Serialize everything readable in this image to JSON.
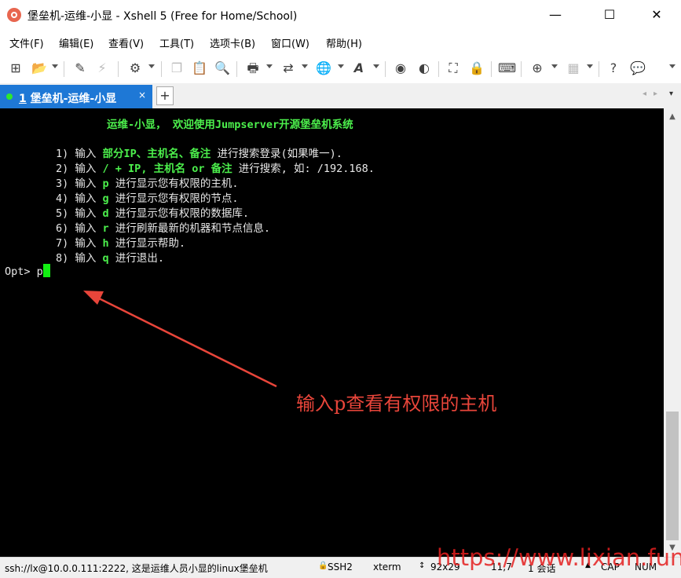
{
  "window": {
    "title": "堡垒机-运维-小显 - Xshell 5 (Free for Home/School)",
    "controls": {
      "minimize": "—",
      "maximize": "☐",
      "close": "✕"
    }
  },
  "menu": [
    "文件(F)",
    "编辑(E)",
    "查看(V)",
    "工具(T)",
    "选项卡(B)",
    "窗口(W)",
    "帮助(H)"
  ],
  "toolbar": {
    "icons": [
      "new-session-icon",
      "open-folder-icon",
      "connect-icon",
      "disconnect-icon",
      "properties-icon",
      "copy-icon",
      "paste-icon",
      "find-icon",
      "print-icon",
      "transfer-icon",
      "globe-icon",
      "font-icon",
      "xftp-icon",
      "script-icon",
      "fullscreen-icon",
      "lock-icon",
      "keyboard-icon",
      "add-tab-icon",
      "layout-icon",
      "help-icon",
      "chat-icon"
    ]
  },
  "tabs": [
    {
      "number": "1",
      "label": "堡垒机-运维-小显",
      "close": "×"
    }
  ],
  "tab_add": "+",
  "terminal": {
    "welcome": {
      "name": "运维-小显，",
      "message": " 欢迎使用Jumpserver开源堡垒机系统"
    },
    "items": [
      {
        "num": "1) 输入 ",
        "key": "部分IP、主机名、备注",
        "desc": " 进行搜索登录(如果唯一)."
      },
      {
        "num": "2) 输入 ",
        "key": "/ + IP, 主机名 or 备注",
        "desc": " 进行搜索, 如: /192.168."
      },
      {
        "num": "3) 输入 ",
        "key": "p",
        "desc": " 进行显示您有权限的主机."
      },
      {
        "num": "4) 输入 ",
        "key": "g",
        "desc": " 进行显示您有权限的节点."
      },
      {
        "num": "5) 输入 ",
        "key": "d",
        "desc": " 进行显示您有权限的数据库."
      },
      {
        "num": "6) 输入 ",
        "key": "r",
        "desc": " 进行刷新最新的机器和节点信息."
      },
      {
        "num": "7) 输入 ",
        "key": "h",
        "desc": " 进行显示帮助."
      },
      {
        "num": "8) 输入 ",
        "key": "q",
        "desc": " 进行退出."
      }
    ],
    "prompt": "Opt> ",
    "input": "p"
  },
  "annotation": "输入p查看有权限的主机",
  "watermark": "https://www.lixian.fun",
  "status": {
    "connection": "ssh://lx@10.0.0.111:2222, 这是运维人员小显的linux堡垒机",
    "protocol": "SSH2",
    "terminal_type": "xterm",
    "size": "92x29",
    "cursor_pos": "11,7",
    "sessions": "1 会话",
    "caps": "CAP",
    "num": "NUM"
  },
  "colors": {
    "terminal_bg": "#000000",
    "highlight": "#4cef4c",
    "tab_active": "#1e78d6",
    "annotation": "#e8453a"
  }
}
